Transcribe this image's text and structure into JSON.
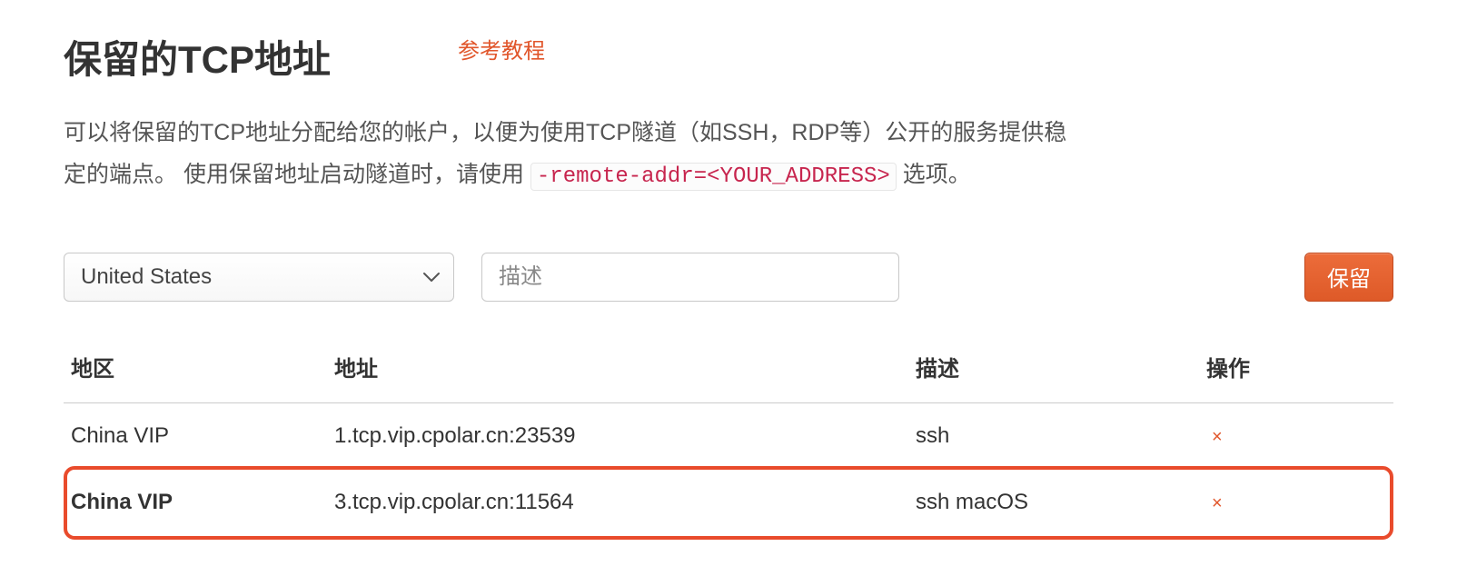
{
  "header": {
    "title": "保留的TCP地址",
    "tutorial_link": "参考教程"
  },
  "description": {
    "part1": "可以将保留的TCP地址分配给您的帐户，以便为使用TCP隧道（如SSH，RDP等）公开的服务提供稳定的端点。 使用保留地址启动隧道时，请使用 ",
    "code": "-remote-addr=<YOUR_ADDRESS>",
    "part2": " 选项。"
  },
  "controls": {
    "region_selected": "United States",
    "desc_placeholder": "描述",
    "reserve_button": "保留"
  },
  "table": {
    "headers": {
      "region": "地区",
      "address": "地址",
      "description": "描述",
      "action": "操作"
    },
    "rows": [
      {
        "region": "China VIP",
        "address": "1.tcp.vip.cpolar.cn:23539",
        "description": "ssh",
        "highlight": false
      },
      {
        "region": "China VIP",
        "address": "3.tcp.vip.cpolar.cn:11564",
        "description": "ssh macOS",
        "highlight": true
      }
    ],
    "delete_label": "×"
  }
}
